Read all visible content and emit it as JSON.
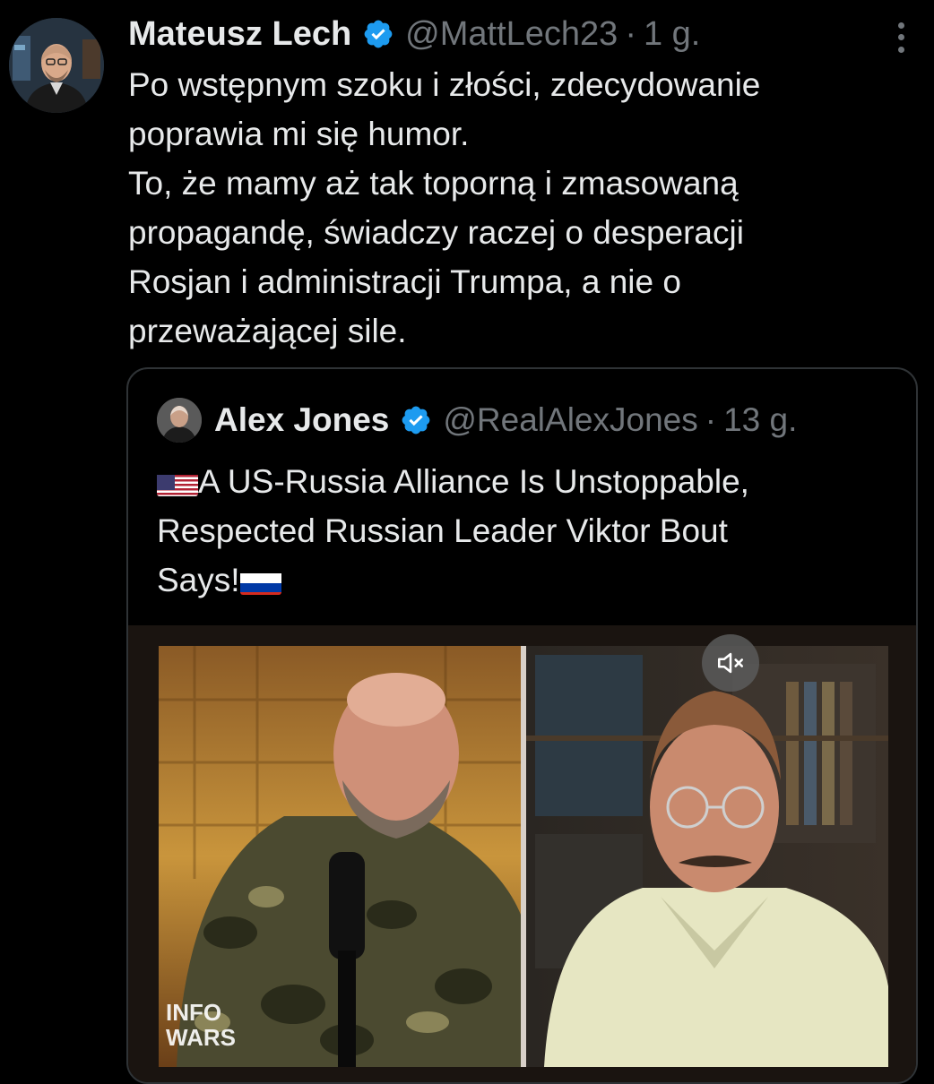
{
  "tweet": {
    "author_name": "Mateusz Lech",
    "handle": "@MattLech23",
    "separator": "·",
    "time": "1 g.",
    "lines": [
      "Po wstępnym szoku i złości, zdecydowanie",
      "poprawia mi się humor.",
      "To, że mamy aż tak toporną i zmasowaną",
      "propagandę, świadczy raczej o desperacji",
      "Rosjan i administracji Trumpa, a nie o",
      "przeważającej sile."
    ],
    "more_icon": "more-vertical-icon",
    "verified_icon": "verified-badge-icon"
  },
  "quote": {
    "author_name": "Alex Jones",
    "handle": "@RealAlexJones",
    "separator": "·",
    "time": "13 g.",
    "lines": [
      "A US-Russia Alliance Is Unstoppable,",
      "Respected Russian Leader Viktor Bout",
      "Says!"
    ],
    "leading_flag": "us-flag-icon",
    "trailing_flag": "russia-flag-icon",
    "media": {
      "type": "video",
      "watermark": "INFO WARS",
      "mute_icon": "volume-muted-icon"
    }
  },
  "colors": {
    "background": "#000000",
    "primary_text": "#e7e9ea",
    "secondary_text": "#71767b",
    "border": "#2f3336",
    "verified": "#1d9bf0"
  }
}
